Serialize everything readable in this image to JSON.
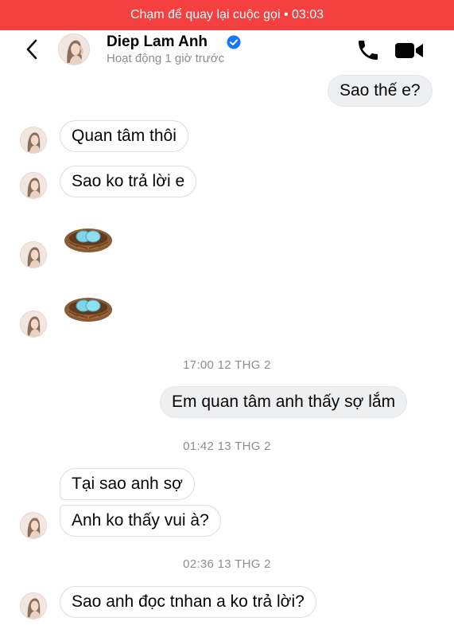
{
  "call_banner": {
    "text": "Chạm để quay lại cuộc gọi • 03:03"
  },
  "header": {
    "name": "Diep Lam Anh",
    "status": "Hoạt động 1 giờ trước"
  },
  "messages": {
    "m1": "Sao thế e?",
    "m2": "Quan tâm thôi",
    "m3": "Sao ko trả lời e",
    "m4": "Em quan tâm anh thấy sợ lắm",
    "m5": "Tại sao anh sợ",
    "m6": "Anh ko thấy vui à?",
    "m7": "Sao anh đọc tnhan a ko trả lời?"
  },
  "timestamps": {
    "t1": "17:00 12 THG 2",
    "t2": "01:42 13 THG 2",
    "t3": "02:36 13 THG 2"
  },
  "stickers": {
    "icon": "bird-nest-eggs-sticker"
  },
  "colors": {
    "call_banner": "#f4403f",
    "verified": "#1877f2",
    "timestamp": "#8a8d91",
    "incoming_border": "#dadde1",
    "outgoing_bg": "#eeeff1"
  }
}
